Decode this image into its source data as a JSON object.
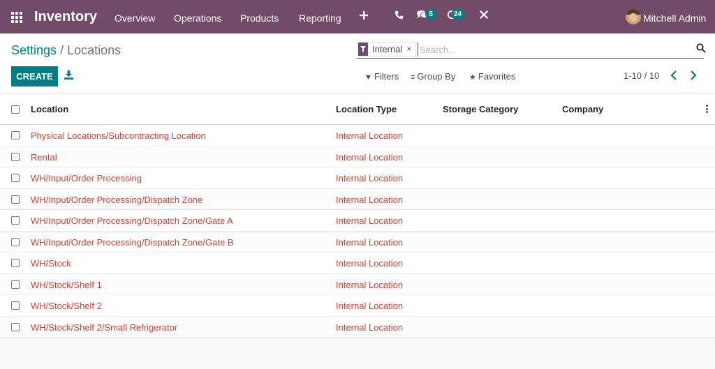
{
  "navbar": {
    "app_name": "Inventory",
    "menu": [
      "Overview",
      "Operations",
      "Products",
      "Reporting"
    ],
    "add_icon": "plus-icon",
    "phone_icon": "phone-icon",
    "chat_icon": "chat-icon",
    "chat_count": "5",
    "activity_icon": "clock-icon",
    "activity_count": "24",
    "tools_icon": "tools-icon",
    "user_name": "Mitchell Admin"
  },
  "breadcrumb": {
    "parent": "Settings",
    "separator": "/",
    "current": "Locations"
  },
  "search": {
    "facet_label": "Internal",
    "facet_close": "×",
    "placeholder": "Search..."
  },
  "toolbar": {
    "create_label": "CREATE",
    "filters_label": "Filters",
    "group_by_label": "Group By",
    "favorites_label": "Favorites",
    "pager": "1-10 / 10"
  },
  "table": {
    "columns": [
      "Location",
      "Location Type",
      "Storage Category",
      "Company"
    ],
    "rows": [
      {
        "location": "Physical Locations/Subcontracting Location",
        "type": "Internal Location"
      },
      {
        "location": "Rental",
        "type": "Internal Location"
      },
      {
        "location": "WH/Input/Order Processing",
        "type": "Internal Location"
      },
      {
        "location": "WH/Input/Order Processing/Dispatch Zone",
        "type": "Internal Location"
      },
      {
        "location": "WH/Input/Order Processing/Dispatch Zone/Gate A",
        "type": "Internal Location"
      },
      {
        "location": "WH/Input/Order Processing/Dispatch Zone/Gate B",
        "type": "Internal Location"
      },
      {
        "location": "WH/Stock",
        "type": "Internal Location"
      },
      {
        "location": "WH/Stock/Shelf 1",
        "type": "Internal Location"
      },
      {
        "location": "WH/Stock/Shelf 2",
        "type": "Internal Location"
      },
      {
        "location": "WH/Stock/Shelf 2/Small Refrigerator",
        "type": "Internal Location"
      }
    ]
  },
  "colors": {
    "brand": "#714b67",
    "primary": "#017e84",
    "link": "#c0453a"
  }
}
